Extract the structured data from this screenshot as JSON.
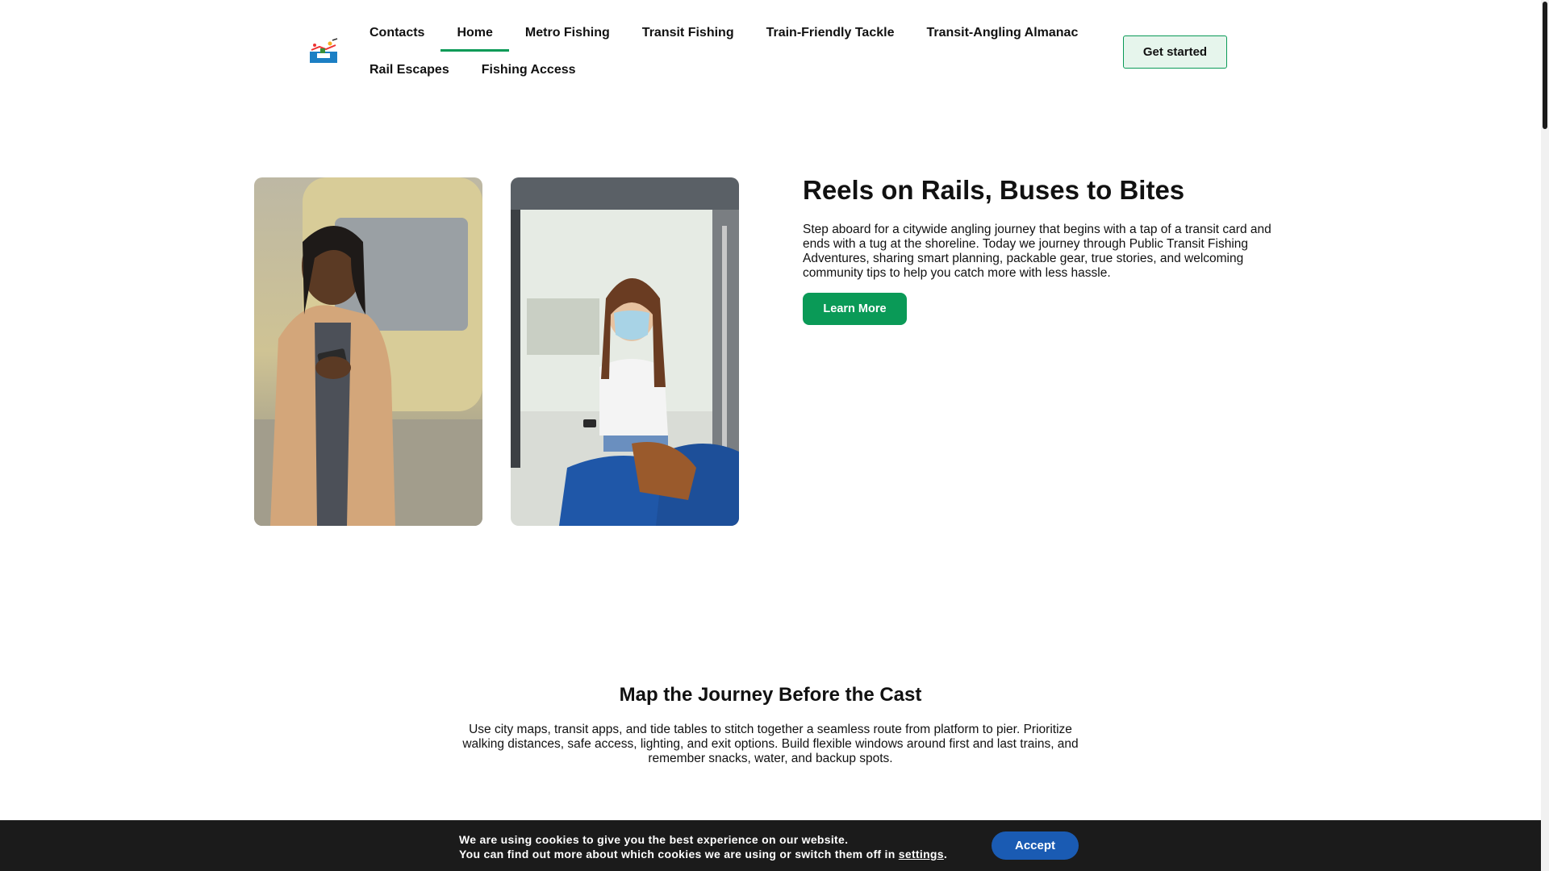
{
  "header": {
    "nav": [
      {
        "label": "Contacts",
        "active": false
      },
      {
        "label": "Home",
        "active": true
      },
      {
        "label": "Metro Fishing",
        "active": false
      },
      {
        "label": "Transit Fishing",
        "active": false
      },
      {
        "label": "Train-Friendly Tackle",
        "active": false
      },
      {
        "label": "Transit-Angling Almanac",
        "active": false
      },
      {
        "label": "Rail Escapes",
        "active": false
      },
      {
        "label": "Fishing Access",
        "active": false
      }
    ],
    "cta_label": "Get started"
  },
  "hero": {
    "title": "Reels on Rails, Buses to Bites",
    "body": "Step aboard for a citywide angling journey that begins with a tap of a transit card and ends with a tug at the shoreline. Today we journey through Public Transit Fishing Adventures, sharing smart planning, packable gear, true stories, and welcoming community tips to help you catch more with less hassle.",
    "button_label": "Learn More"
  },
  "section": {
    "title": "Map the Journey Before the Cast",
    "body": "Use city maps, transit apps, and tide tables to stitch together a seamless route from platform to pier. Prioritize walking distances, safe access, lighting, and exit options. Build flexible windows around first and last trains, and remember snacks, water, and backup spots."
  },
  "cookie": {
    "line1": "We are using cookies to give you the best experience on our website.",
    "line2_prefix": "You can find out more about which cookies we are using or switch them off in ",
    "settings_link": "settings",
    "line2_suffix": ".",
    "accept_label": "Accept"
  },
  "colors": {
    "accent_green": "#0a9a57",
    "cta_background": "#e6f5ec",
    "cookie_bar": "#1b1b1b",
    "accept_blue": "#1a5bb3"
  },
  "icons": {
    "logo": "fishing-logo-icon"
  }
}
